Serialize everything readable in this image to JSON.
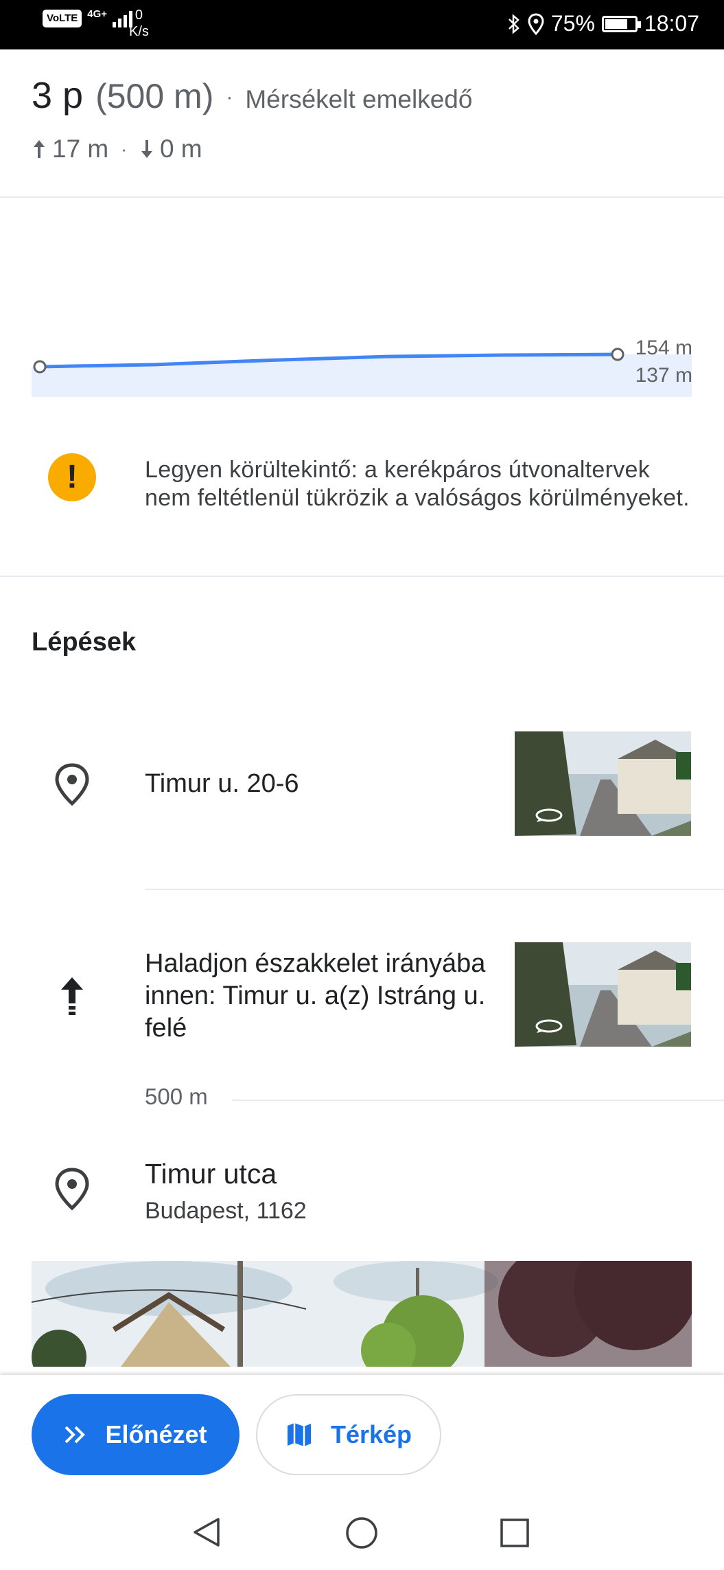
{
  "status_bar": {
    "volte": "VoLTE",
    "network": "4G+",
    "speed_value": "0",
    "speed_unit": "K/s",
    "battery": "75%",
    "time": "18:07"
  },
  "summary": {
    "duration": "3 p",
    "distance": "(500 m)",
    "separator": "·",
    "grade": "Mérsékelt emelkedő",
    "ascent": "17 m",
    "descent": "0 m"
  },
  "chart_data": {
    "type": "area",
    "x": [
      0,
      0.2,
      0.4,
      0.6,
      0.8,
      1.0
    ],
    "values": [
      137,
      140,
      146,
      151,
      153,
      154
    ],
    "ylim": [
      137,
      154
    ],
    "y_tick_labels": [
      "154 m",
      "137 m"
    ],
    "grid": false,
    "colors": {
      "line": "#4285f4",
      "fill": "#e8f0fe"
    }
  },
  "warning": {
    "icon": "!",
    "text": "Legyen körültekintő: a kerékpáros útvonaltervek nem feltétlenül tükrözik a valóságos körülményeket."
  },
  "steps": {
    "title": "Lépések",
    "items": [
      {
        "icon": "place-pin-icon",
        "text": "Timur u. 20-6"
      },
      {
        "icon": "straight-arrow-icon",
        "text": "Haladjon északkelet irányába innen: Timur u. a(z) Istráng u. felé",
        "distance": "500 m"
      },
      {
        "icon": "place-pin-icon",
        "title": "Timur utca",
        "subtitle": "Budapest, 1162"
      }
    ]
  },
  "buttons": {
    "preview": "Előnézet",
    "map": "Térkép"
  },
  "colors": {
    "accent": "#1a73e8",
    "warning": "#f9ab00"
  }
}
